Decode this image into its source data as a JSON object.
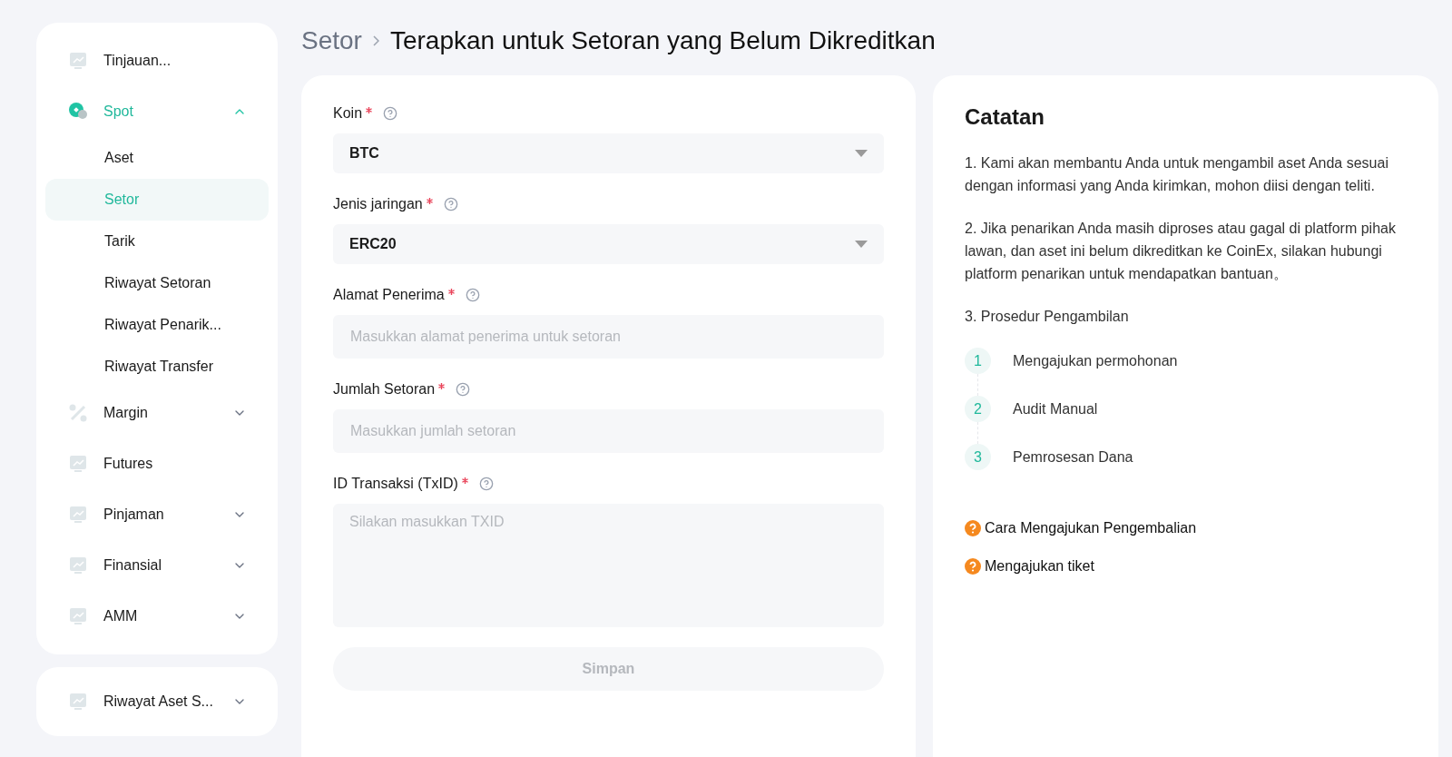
{
  "sidebar": {
    "items": [
      {
        "label": "Tinjauan...",
        "selected": false
      },
      {
        "label": "Spot",
        "selected": true,
        "expanded": true,
        "children": [
          {
            "label": "Aset",
            "selected": false
          },
          {
            "label": "Setor",
            "selected": true
          },
          {
            "label": "Tarik",
            "selected": false
          },
          {
            "label": "Riwayat Setoran",
            "selected": false
          },
          {
            "label": "Riwayat Penarik...",
            "selected": false
          },
          {
            "label": "Riwayat Transfer",
            "selected": false
          }
        ]
      },
      {
        "label": "Margin",
        "selected": false,
        "expanded": false
      },
      {
        "label": "Futures",
        "selected": false
      },
      {
        "label": "Pinjaman",
        "selected": false,
        "expanded": false
      },
      {
        "label": "Finansial",
        "selected": false,
        "expanded": false
      },
      {
        "label": "AMM",
        "selected": false,
        "expanded": false
      }
    ],
    "footer_item": {
      "label": "Riwayat Aset S...",
      "expanded": false
    }
  },
  "breadcrumb": [
    "Setor",
    "Terapkan untuk Setoran yang Belum Dikreditkan"
  ],
  "form": {
    "fields": [
      {
        "kind": "select",
        "label": "Koin",
        "required": true,
        "value": "BTC"
      },
      {
        "kind": "select",
        "label": "Jenis jaringan",
        "required": true,
        "value": "ERC20"
      },
      {
        "kind": "input",
        "label": "Alamat Penerima",
        "required": true,
        "placeholder": "Masukkan alamat penerima untuk setoran"
      },
      {
        "kind": "input",
        "label": "Jumlah Setoran",
        "required": true,
        "placeholder": "Masukkan jumlah setoran"
      },
      {
        "kind": "textarea",
        "label": "ID Transaksi (TxID)",
        "required": true,
        "placeholder": "Silakan masukkan TXID"
      }
    ],
    "submit": {
      "label": "Simpan",
      "disabled": true
    }
  },
  "notes": {
    "title": "Catatan",
    "paragraphs": [
      "1. Kami akan membantu Anda untuk mengambil aset Anda sesuai dengan informasi yang Anda kirimkan, mohon diisi dengan teliti.",
      "2. Jika penarikan Anda masih diproses atau gagal di platform pihak lawan, dan aset ini belum dikreditkan ke CoinEx, silakan hubungi platform penarikan untuk mendapatkan bantuan。",
      "3. Prosedur Pengambilan"
    ],
    "steps": [
      {
        "number": "1",
        "label": "Mengajukan permohonan"
      },
      {
        "number": "2",
        "label": "Audit Manual"
      },
      {
        "number": "3",
        "label": "Pemrosesan Dana"
      }
    ],
    "links": [
      "Cara Mengajukan Pengembalian",
      "Mengajukan tiket"
    ]
  }
}
